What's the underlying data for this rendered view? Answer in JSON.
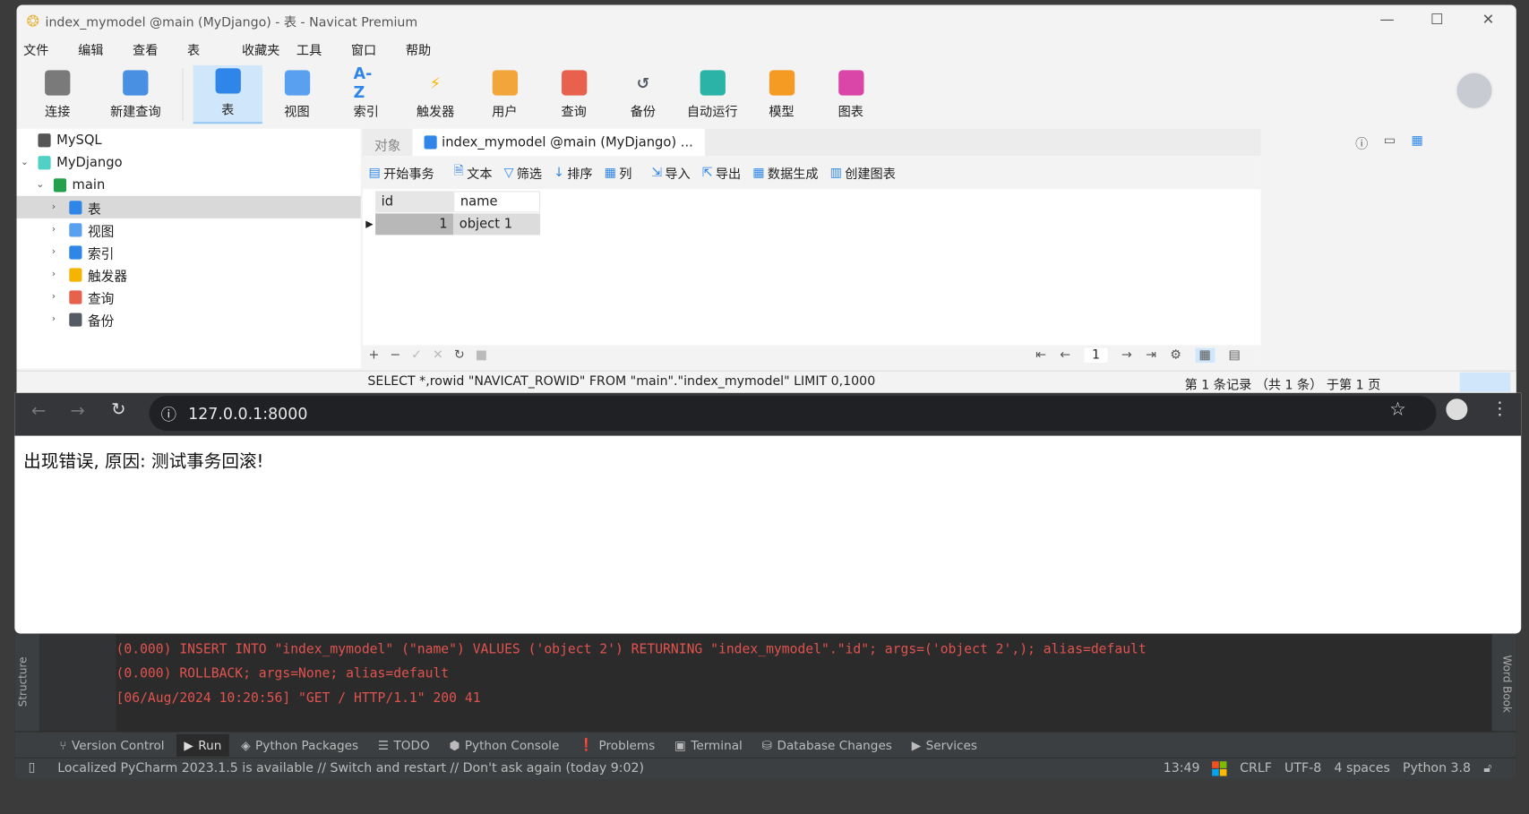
{
  "navicat": {
    "title": "index_mymodel @main (MyDjango) - 表 - Navicat Premium",
    "menu": [
      "文件",
      "编辑",
      "查看",
      "表",
      "收藏夹",
      "工具",
      "窗口",
      "帮助"
    ],
    "toolbar": [
      {
        "label": "连接",
        "icon": "connect-icon",
        "color": "#7a7a7a"
      },
      {
        "label": "新建查询",
        "icon": "new-query-icon",
        "color": "#4a90e2"
      },
      {
        "label": "表",
        "icon": "table-icon",
        "color": "#2f86e8",
        "selected": true
      },
      {
        "label": "视图",
        "icon": "view-icon",
        "color": "#5aa0f0"
      },
      {
        "label": "索引",
        "icon": "index-icon",
        "color": "#2f86e8",
        "glyph": "A-Z"
      },
      {
        "label": "触发器",
        "icon": "trigger-icon",
        "color": "#f5b400",
        "glyph": "⚡"
      },
      {
        "label": "用户",
        "icon": "user-icon",
        "color": "#f2a53a"
      },
      {
        "label": "查询",
        "icon": "query-icon",
        "color": "#e8614c"
      },
      {
        "label": "备份",
        "icon": "backup-icon",
        "color": "#555b63",
        "glyph": "↺"
      },
      {
        "label": "自动运行",
        "icon": "robot-icon",
        "color": "#2bb3a8"
      },
      {
        "label": "模型",
        "icon": "model-icon",
        "color": "#f59a23"
      },
      {
        "label": "图表",
        "icon": "chart-icon",
        "color": "#d946a8"
      }
    ],
    "tree": [
      {
        "label": "MySQL",
        "level": 0,
        "color": "#555"
      },
      {
        "label": "MyDjango",
        "level": 0,
        "expanded": true,
        "color": "#4fd1c5"
      },
      {
        "label": "main",
        "level": 1,
        "expanded": true,
        "color": "#22a04b"
      },
      {
        "label": "表",
        "level": 2,
        "selected": true,
        "color": "#2f86e8"
      },
      {
        "label": "视图",
        "level": 2,
        "color": "#5aa0f0"
      },
      {
        "label": "索引",
        "level": 2,
        "color": "#2f86e8"
      },
      {
        "label": "触发器",
        "level": 2,
        "color": "#f5b400"
      },
      {
        "label": "查询",
        "level": 2,
        "color": "#e8614c"
      },
      {
        "label": "备份",
        "level": 2,
        "color": "#555b63"
      }
    ],
    "tabs": {
      "objects": "对象",
      "active": "index_mymodel @main (MyDjango) ..."
    },
    "obj_toolbar": [
      "开始事务",
      "文本",
      "筛选",
      "排序",
      "列",
      "导入",
      "导出",
      "数据生成",
      "创建图表"
    ],
    "table": {
      "columns": [
        "id",
        "name"
      ],
      "rows": [
        [
          "1",
          "object 1"
        ]
      ]
    },
    "nav": {
      "buttons": [
        "+",
        "−",
        "✓",
        "✕",
        "↻",
        "■"
      ],
      "page": "1"
    },
    "sql": "SELECT *,rowid \"NAVICAT_ROWID\" FROM \"main\".\"index_mymodel\" LIMIT 0,1000",
    "record_status": "第 1 条记录 （共 1 条） 于第 1 页"
  },
  "browser": {
    "url": "127.0.0.1:8000",
    "message": "出现错误, 原因: 测试事务回滚!"
  },
  "pycharm": {
    "log": [
      "(0.000) INSERT INTO \"index_mymodel\" (\"name\") VALUES ('object 2') RETURNING \"index_mymodel\".\"id\"; args=('object 2',); alias=default",
      "(0.000) ROLLBACK; args=None; alias=default",
      "[06/Aug/2024 10:20:56] \"GET / HTTP/1.1\" 200 41"
    ],
    "left_panel": "Structure",
    "right_panel": "Word Book",
    "tool_tabs": [
      "Version Control",
      "Run",
      "Python Packages",
      "TODO",
      "Python Console",
      "Problems",
      "Terminal",
      "Database Changes",
      "Services"
    ],
    "active_tool_tab": "Run",
    "status": "Localized PyCharm 2023.1.5 is available // Switch and restart // Don't ask again (today 9:02)",
    "right_status": [
      "13:49",
      "CRLF",
      "UTF-8",
      "4 spaces",
      "Python 3.8"
    ]
  }
}
